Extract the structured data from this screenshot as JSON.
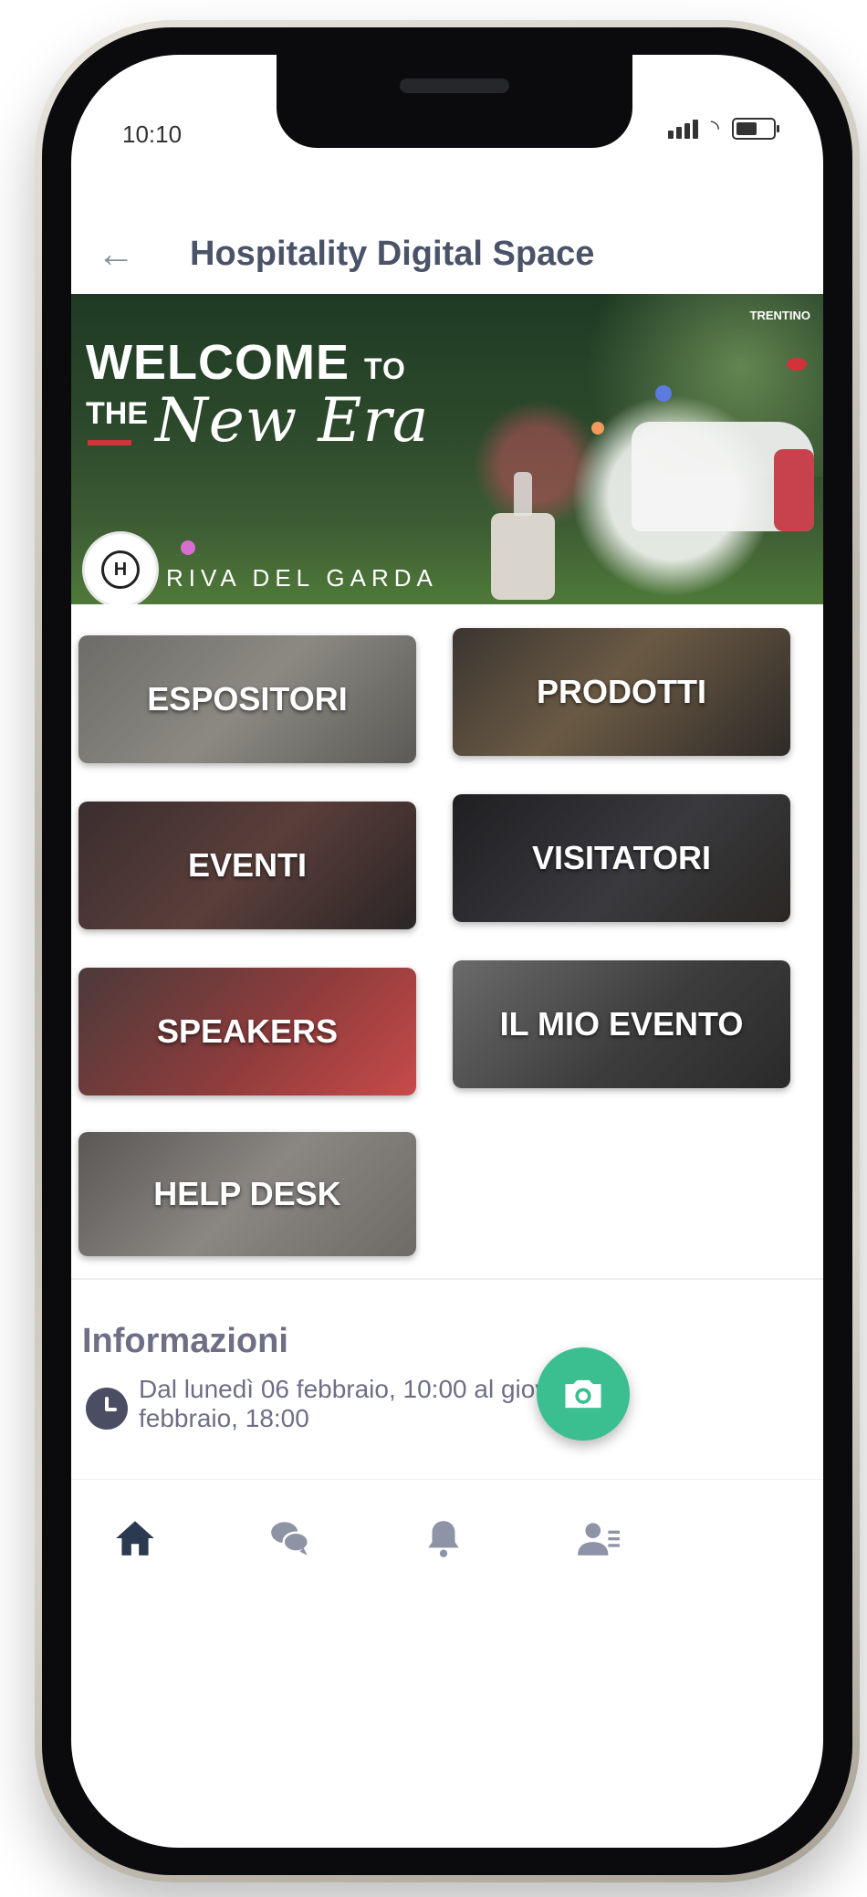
{
  "status_bar": {
    "time": "10:10"
  },
  "header": {
    "title": "Hospitality Digital Space"
  },
  "banner": {
    "welcome": "WELCOME",
    "to": "TO",
    "the": "THE",
    "new_era": "New Era",
    "brand": "TRENTINO",
    "location": "RIVA DEL GARDA"
  },
  "tiles": {
    "espositori": "ESPOSITORI",
    "prodotti": "PRODOTTI",
    "eventi": "EVENTI",
    "visitatori": "VISITATORI",
    "speakers": "SPEAKERS",
    "il_mio_evento": "IL MIO EVENTO",
    "help_desk": "HELP DESK"
  },
  "info": {
    "title": "Informazioni",
    "date_text": "Dal lunedì 06 febbraio, 10:00 al giove\nfebbraio, 18:00"
  },
  "colors": {
    "accent": "#3bbf90",
    "title": "#4a5368",
    "nav_active": "#2b3a4f"
  },
  "icons": {
    "back": "arrow-left-icon",
    "fab": "camera-icon",
    "nav": [
      "home-icon",
      "chat-icon",
      "bell-icon",
      "profile-list-icon"
    ]
  }
}
